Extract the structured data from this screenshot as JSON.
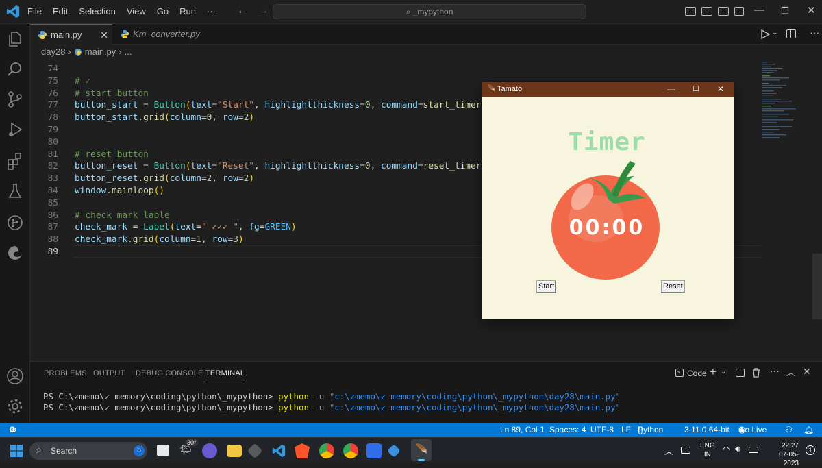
{
  "titlebar": {
    "menu": [
      "File",
      "Edit",
      "Selection",
      "View",
      "Go",
      "Run",
      "···"
    ],
    "search_text": "_mypython"
  },
  "tabs": [
    {
      "label": "main.py",
      "active": true
    },
    {
      "label": "Km_converter.py",
      "active": false
    }
  ],
  "breadcrumb": {
    "folder": "day28",
    "file": "main.py",
    "tail": "..."
  },
  "editor": {
    "line_numbers": [
      "74",
      "75",
      "76",
      "77",
      "78",
      "79",
      "80",
      "81",
      "82",
      "83",
      "84",
      "85",
      "86",
      "87",
      "88",
      "89"
    ],
    "current_line": "89"
  },
  "tk": {
    "title": "Tamato",
    "heading": "Timer",
    "time": "00:00",
    "start_label": "Start",
    "reset_label": "Reset",
    "colors": {
      "bg": "#f7f5dd",
      "heading": "#9bdeac",
      "tomato": "#f26849",
      "title_bar": "#6b3619"
    }
  },
  "panel": {
    "tabs": [
      "PROBLEMS",
      "OUTPUT",
      "DEBUG CONSOLE",
      "TERMINAL"
    ],
    "active_tab": "TERMINAL",
    "code_label": "Code",
    "terminal_prompt": "PS C:\\zmemo\\z memory\\coding\\python\\_mypython>",
    "terminal_cmd": "python",
    "terminal_flag": "-u",
    "terminal_path": "\"c:\\zmemo\\z memory\\coding\\python\\_mypython\\day28\\main.py\""
  },
  "status": {
    "errors": "0",
    "warnings": "0",
    "position": "Ln 89, Col 1",
    "spaces": "Spaces: 4",
    "encoding": "UTF-8",
    "eol": "LF",
    "language": "Python",
    "interpreter": "3.11.0 64-bit",
    "golive": "Go Live"
  },
  "taskbar": {
    "search": "Search",
    "weather": "30°",
    "lang_top": "ENG",
    "lang_bottom": "IN",
    "time": "22:27",
    "date": "07-05-2023",
    "notif": "1"
  },
  "colors": {
    "accent": "#0078d4",
    "editor_bg": "#1f1f1f"
  }
}
